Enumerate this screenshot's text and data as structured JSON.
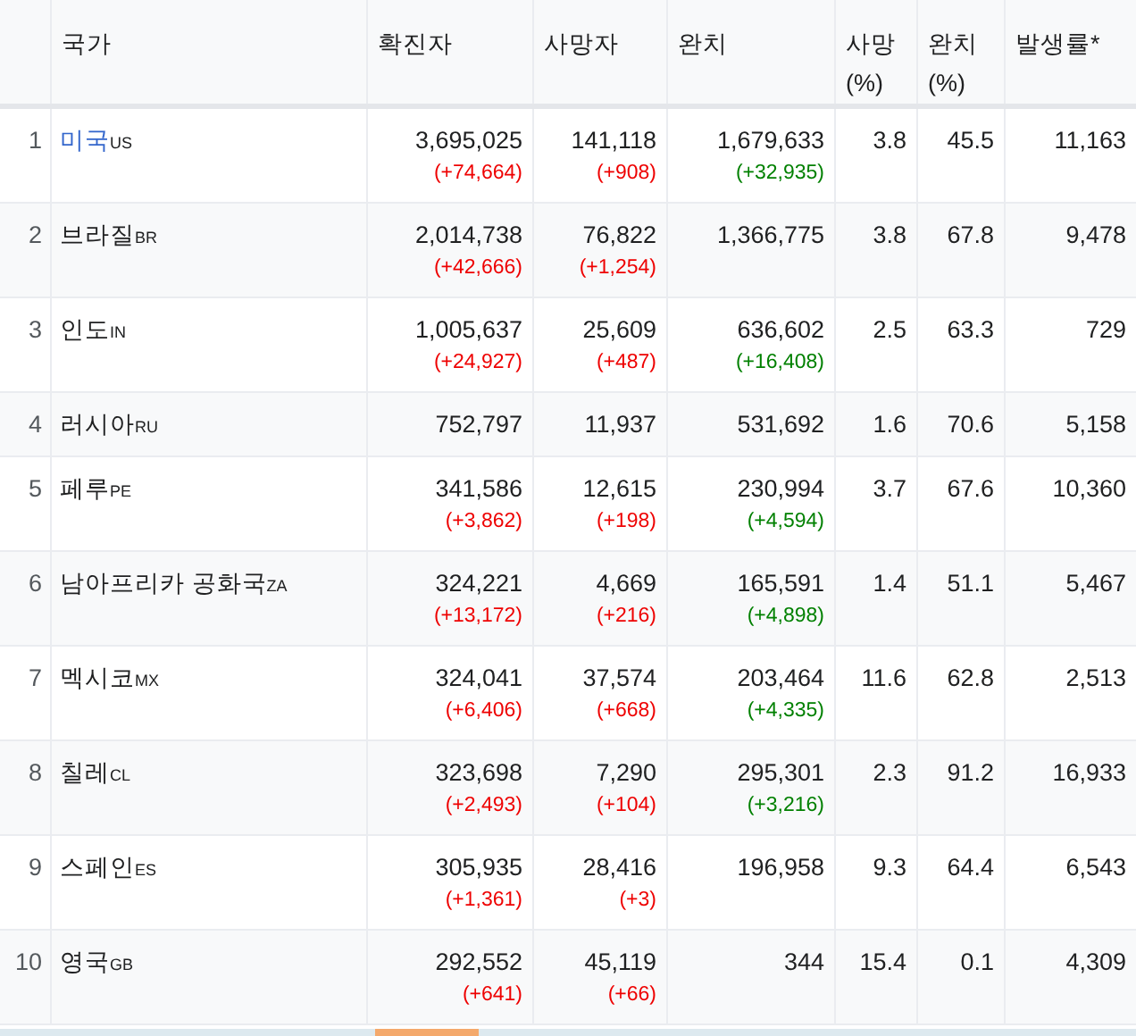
{
  "columns": [
    "국가",
    "확진자",
    "사망자",
    "완치",
    "사망 (%)",
    "완치 (%)",
    "발생률*"
  ],
  "rows": [
    {
      "rank": "1",
      "country": "미국",
      "code": "US",
      "link": true,
      "confirmed": "3,695,025",
      "confirmed_delta": "(+74,664)",
      "deaths": "141,118",
      "deaths_delta": "(+908)",
      "recovered": "1,679,633",
      "recovered_delta": "(+32,935)",
      "death_pct": "3.8",
      "recovered_pct": "45.5",
      "rate": "11,163"
    },
    {
      "rank": "2",
      "country": "브라질",
      "code": "BR",
      "link": false,
      "confirmed": "2,014,738",
      "confirmed_delta": "(+42,666)",
      "deaths": "76,822",
      "deaths_delta": "(+1,254)",
      "recovered": "1,366,775",
      "death_pct": "3.8",
      "recovered_pct": "67.8",
      "rate": "9,478"
    },
    {
      "rank": "3",
      "country": "인도",
      "code": "IN",
      "link": false,
      "confirmed": "1,005,637",
      "confirmed_delta": "(+24,927)",
      "deaths": "25,609",
      "deaths_delta": "(+487)",
      "recovered": "636,602",
      "recovered_delta": "(+16,408)",
      "death_pct": "2.5",
      "recovered_pct": "63.3",
      "rate": "729"
    },
    {
      "rank": "4",
      "country": "러시아",
      "code": "RU",
      "link": false,
      "confirmed": "752,797",
      "deaths": "11,937",
      "recovered": "531,692",
      "death_pct": "1.6",
      "recovered_pct": "70.6",
      "rate": "5,158"
    },
    {
      "rank": "5",
      "country": "페루",
      "code": "PE",
      "link": false,
      "confirmed": "341,586",
      "confirmed_delta": "(+3,862)",
      "deaths": "12,615",
      "deaths_delta": "(+198)",
      "recovered": "230,994",
      "recovered_delta": "(+4,594)",
      "death_pct": "3.7",
      "recovered_pct": "67.6",
      "rate": "10,360"
    },
    {
      "rank": "6",
      "country": "남아프리카 공화국",
      "code": "ZA",
      "link": false,
      "confirmed": "324,221",
      "confirmed_delta": "(+13,172)",
      "deaths": "4,669",
      "deaths_delta": "(+216)",
      "recovered": "165,591",
      "recovered_delta": "(+4,898)",
      "death_pct": "1.4",
      "recovered_pct": "51.1",
      "rate": "5,467"
    },
    {
      "rank": "7",
      "country": "멕시코",
      "code": "MX",
      "link": false,
      "confirmed": "324,041",
      "confirmed_delta": "(+6,406)",
      "deaths": "37,574",
      "deaths_delta": "(+668)",
      "recovered": "203,464",
      "recovered_delta": "(+4,335)",
      "death_pct": "11.6",
      "recovered_pct": "62.8",
      "rate": "2,513"
    },
    {
      "rank": "8",
      "country": "칠레",
      "code": "CL",
      "link": false,
      "confirmed": "323,698",
      "confirmed_delta": "(+2,493)",
      "deaths": "7,290",
      "deaths_delta": "(+104)",
      "recovered": "295,301",
      "recovered_delta": "(+3,216)",
      "death_pct": "2.3",
      "recovered_pct": "91.2",
      "rate": "16,933"
    },
    {
      "rank": "9",
      "country": "스페인",
      "code": "ES",
      "link": false,
      "confirmed": "305,935",
      "confirmed_delta": "(+1,361)",
      "deaths": "28,416",
      "deaths_delta": "(+3)",
      "recovered": "196,958",
      "death_pct": "9.3",
      "recovered_pct": "64.4",
      "rate": "6,543"
    },
    {
      "rank": "10",
      "country": "영국",
      "code": "GB",
      "link": false,
      "confirmed": "292,552",
      "confirmed_delta": "(+641)",
      "deaths": "45,119",
      "deaths_delta": "(+66)",
      "recovered": "344",
      "death_pct": "15.4",
      "recovered_pct": "0.1",
      "rate": "4,309"
    }
  ]
}
